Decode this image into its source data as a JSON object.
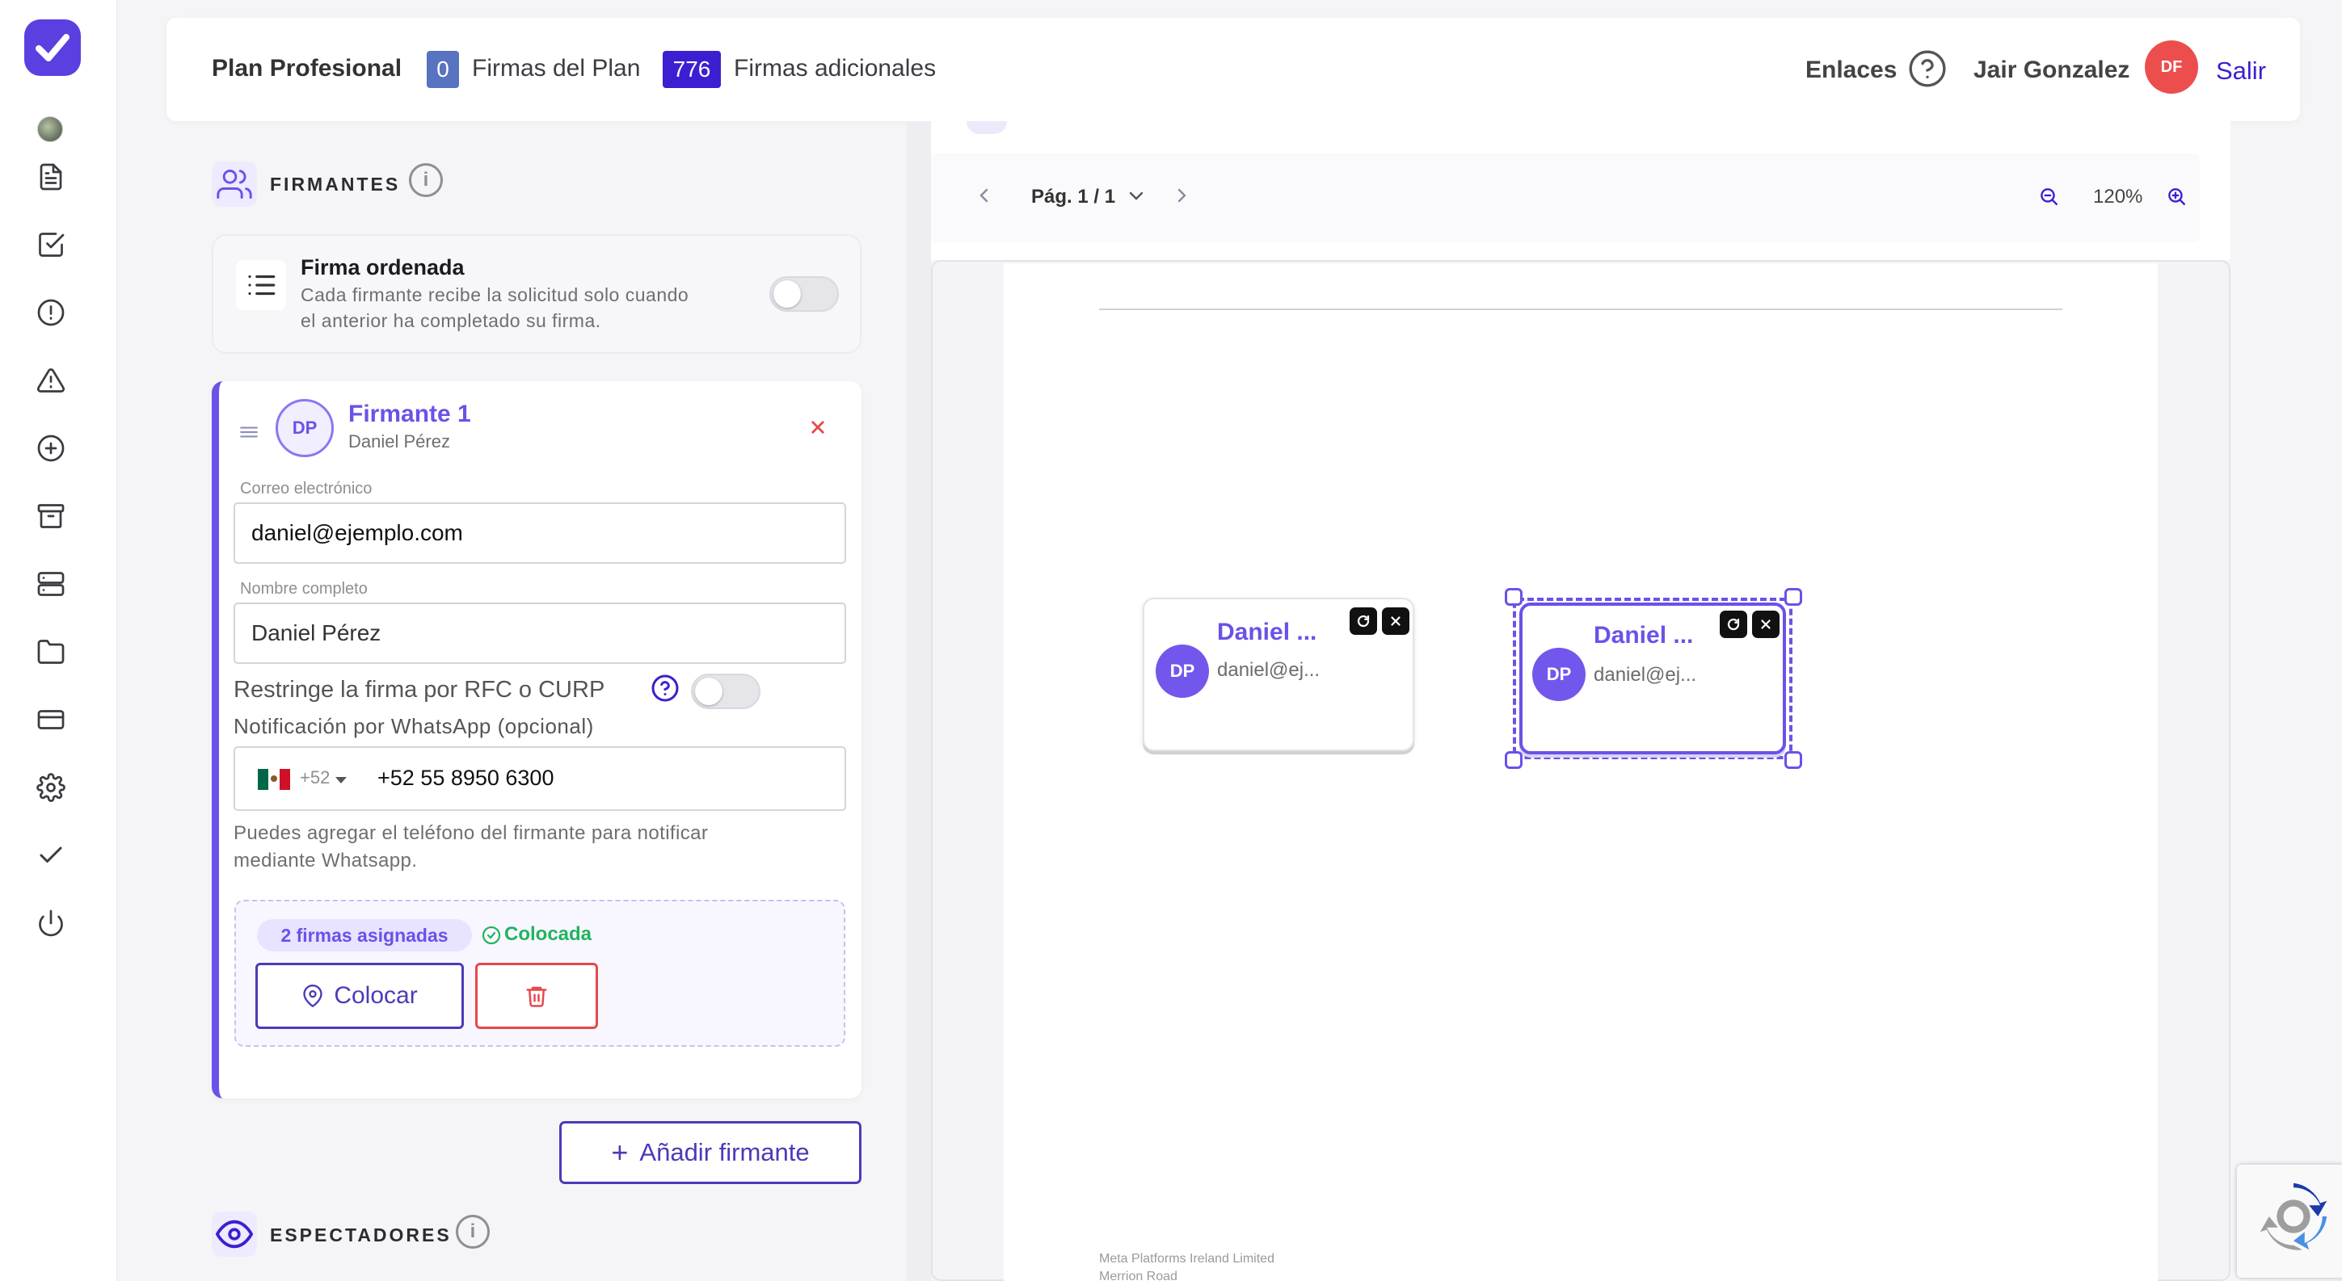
{
  "topbar": {
    "plan_name": "Plan Profesional",
    "plan_count": "0",
    "plan_label": "Firmas del Plan",
    "extra_count": "776",
    "extra_label": "Firmas adicionales",
    "links_label": "Enlaces",
    "user_name": "Jair Gonzalez",
    "user_initials": "DF",
    "logout_label": "Salir",
    "colors": {
      "plan_badge": "#5873bf",
      "extra_badge": "#3b1fd1",
      "avatar": "#ec4e4e"
    }
  },
  "sidebar": {
    "icons": [
      "globe-icon",
      "document-icon",
      "check-square-icon",
      "alert-circle-icon",
      "warning-triangle-icon",
      "plus-circle-icon",
      "archive-icon",
      "server-icon",
      "folder-icon",
      "credit-card-icon",
      "gear-icon",
      "check-icon",
      "power-icon"
    ]
  },
  "signers_section": {
    "title": "FIRMANTES",
    "ordered": {
      "title": "Firma ordenada",
      "description_line1": "Cada firmante recibe la solicitud solo cuando",
      "description_line2": "el anterior ha completado su firma.",
      "enabled": false
    },
    "signer": {
      "initials": "DP",
      "title": "Firmante 1",
      "name": "Daniel Pérez",
      "email_label": "Correo electrónico",
      "email_value": "daniel@ejemplo.com",
      "fullname_label": "Nombre completo",
      "fullname_value": "Daniel Pérez",
      "rfc_label": "Restringe la firma por RFC o CURP",
      "rfc_enabled": false,
      "whatsapp_label": "Notificación por WhatsApp (opcional)",
      "phone_prefix": "+52",
      "phone_value": "+52 55 8950 6300",
      "phone_help_line1": "Puedes agregar el teléfono del firmante para notificar",
      "phone_help_line2": "mediante Whatsapp.",
      "assigned_badge": "2 firmas asignadas",
      "placed_label": "Colocada",
      "place_button": "Colocar"
    },
    "add_button": "Añadir firmante"
  },
  "spectators_section": {
    "title": "ESPECTADORES"
  },
  "viewer": {
    "page_label": "Pág. 1 / 1",
    "zoom": "120%",
    "signature_boxes": [
      {
        "initials": "DP",
        "name": "Daniel ...",
        "email": "daniel@ej...",
        "selected": false
      },
      {
        "initials": "DP",
        "name": "Daniel ...",
        "email": "daniel@ej...",
        "selected": true
      }
    ],
    "footer_line1": "Meta Platforms Ireland Limited",
    "footer_line2": "Merrion Road"
  }
}
